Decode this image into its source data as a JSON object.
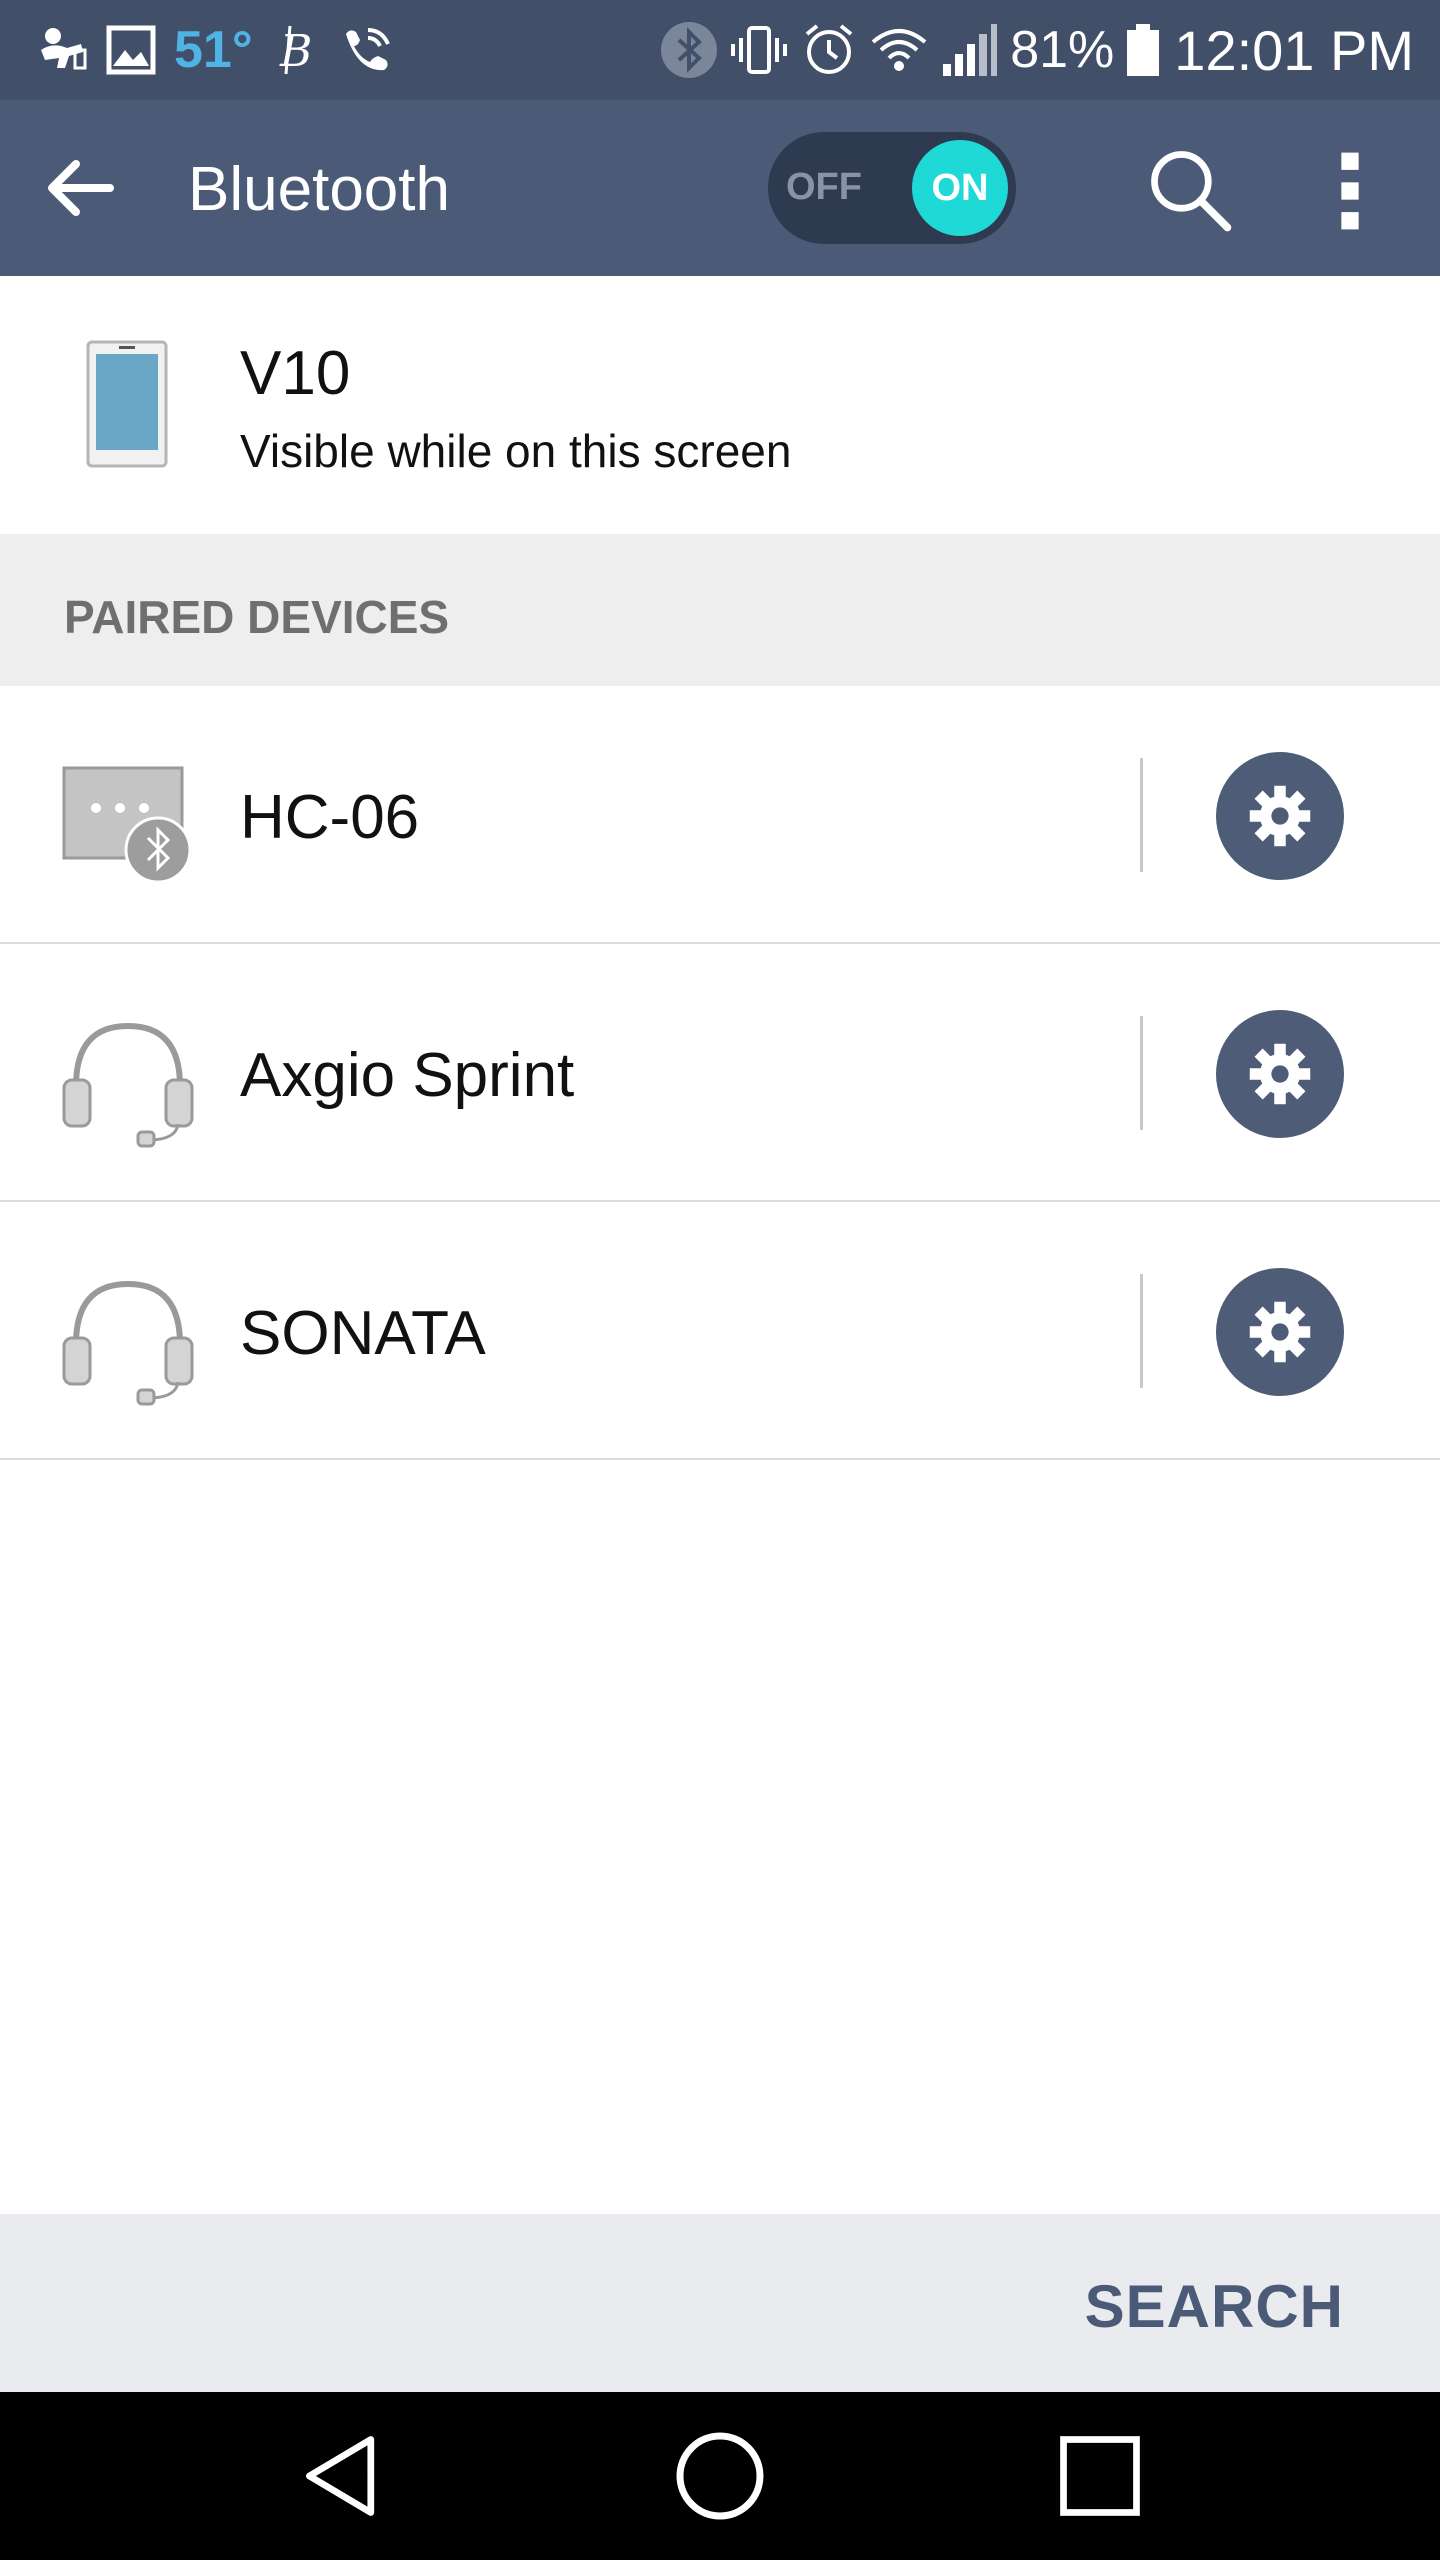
{
  "status_bar": {
    "temperature": "51°",
    "battery_percent": "81%",
    "time": "12:01 PM",
    "left_icons": [
      "baby-icon",
      "image-icon",
      "bitcoin-icon",
      "wifi-calling-icon"
    ],
    "right_icons": [
      "bluetooth-icon",
      "vibrate-icon",
      "alarm-icon",
      "wifi-icon",
      "signal-icon",
      "battery-icon"
    ]
  },
  "app_bar": {
    "title": "Bluetooth",
    "toggle_off_label": "OFF",
    "toggle_on_label": "ON",
    "toggle_state": "on"
  },
  "own_device": {
    "name": "V10",
    "status": "Visible while on this screen"
  },
  "paired_section": {
    "title": "PAIRED DEVICES"
  },
  "paired_devices": [
    {
      "name": "HC-06",
      "icon": "bluetooth-device-icon"
    },
    {
      "name": "Axgio Sprint",
      "icon": "headset-icon"
    },
    {
      "name": "SONATA",
      "icon": "headset-icon"
    }
  ],
  "action_bar": {
    "search_label": "SEARCH"
  },
  "colors": {
    "status_bar": "#414f69",
    "app_bar": "#4b5a77",
    "toggle_on": "#1ed9d6",
    "settings_button": "#4e5c78",
    "section_bg": "#eeeeee",
    "action_bar_bg": "#e9ebef"
  }
}
